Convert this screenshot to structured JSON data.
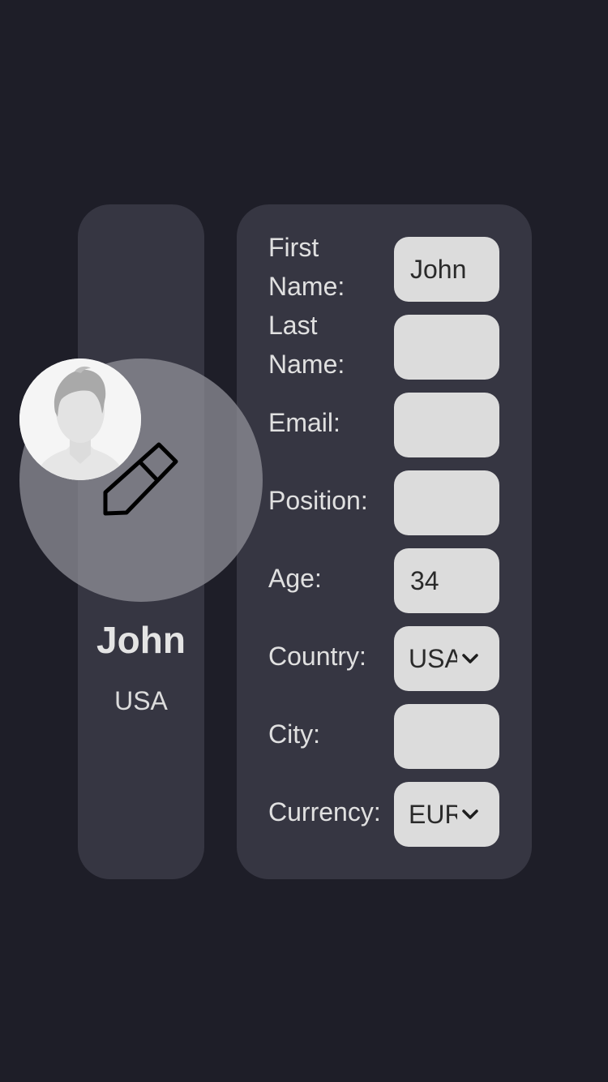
{
  "profile": {
    "name": "John",
    "country": "USA"
  },
  "form": {
    "fields": [
      {
        "label": "First Name:",
        "value": "John",
        "type": "text"
      },
      {
        "label": "Last Name:",
        "value": "",
        "type": "text"
      },
      {
        "label": "Email:",
        "value": "",
        "type": "text"
      },
      {
        "label": "Position:",
        "value": "",
        "type": "text"
      },
      {
        "label": "Age:",
        "value": "34",
        "type": "text"
      },
      {
        "label": "Country:",
        "value": "USA",
        "type": "select"
      },
      {
        "label": "City:",
        "value": "",
        "type": "text"
      },
      {
        "label": "Currency:",
        "value": "EUR",
        "type": "select"
      }
    ]
  },
  "icons": {
    "avatar": "person-silhouette-icon",
    "edit": "pencil-icon",
    "dropdown": "chevron-down-icon"
  },
  "colors": {
    "background": "#1e1e28",
    "card": "#363642",
    "input": "#dcdcdc"
  }
}
